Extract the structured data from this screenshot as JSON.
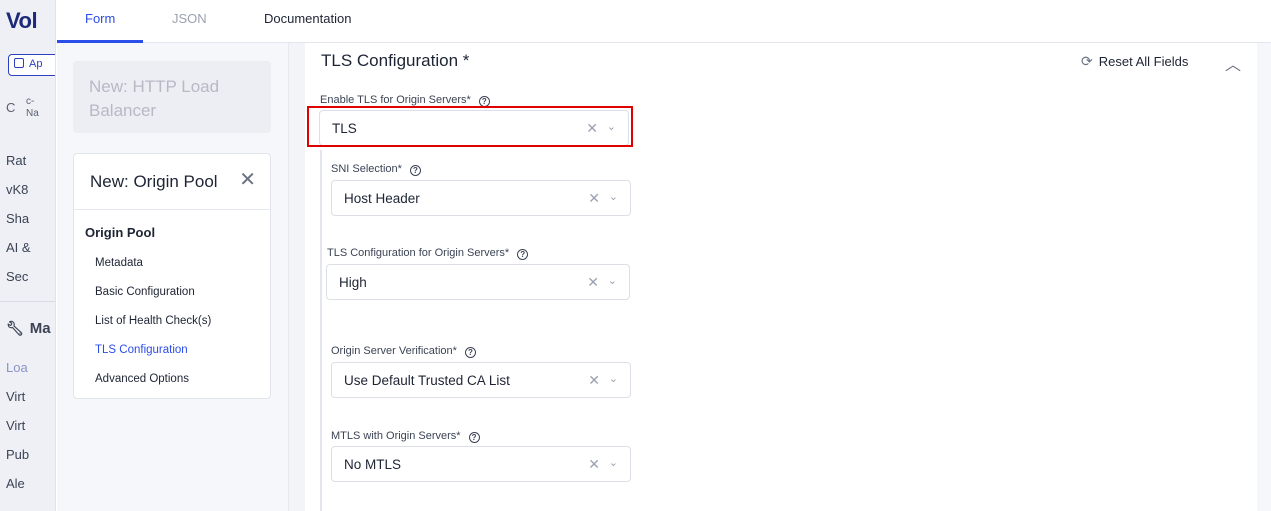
{
  "app_sidebar": {
    "logo": "Vol",
    "button_label": "Ap",
    "tenant_initial": "C",
    "tenant_line1": "c-",
    "tenant_line2": "Na",
    "nav_items": [
      {
        "label": "Rat"
      },
      {
        "label": "vK8"
      },
      {
        "label": "Sha"
      },
      {
        "label": "AI &"
      },
      {
        "label": "Sec"
      }
    ],
    "section_label": "Ma",
    "section_items": [
      {
        "label": "Loa",
        "active": true
      },
      {
        "label": "Virt"
      },
      {
        "label": "Virt"
      },
      {
        "label": "Pub"
      },
      {
        "label": "Ale"
      }
    ]
  },
  "tabs": [
    {
      "label": "Form",
      "active": true
    },
    {
      "label": "JSON"
    },
    {
      "label": "Documentation"
    }
  ],
  "left_panel": {
    "parent_card_title": "New: HTTP Load Balancer",
    "card_title": "New: Origin Pool",
    "close_icon": "✕",
    "heading": "Origin Pool",
    "items": [
      {
        "label": "Metadata"
      },
      {
        "label": "Basic Configuration"
      },
      {
        "label": "List of Health Check(s)"
      },
      {
        "label": "TLS Configuration",
        "active": true
      },
      {
        "label": "Advanced Options"
      }
    ]
  },
  "main": {
    "section_title": "TLS Configuration *",
    "reset_label": "Reset All Fields",
    "fields": [
      {
        "label": "Enable TLS for Origin Servers*",
        "value": "TLS"
      },
      {
        "label": "SNI Selection*",
        "value": "Host Header"
      },
      {
        "label": "TLS Configuration for Origin Servers*",
        "value": "High"
      },
      {
        "label": "Origin Server Verification*",
        "value": "Use Default Trusted CA List"
      },
      {
        "label": "MTLS with Origin Servers*",
        "value": "No MTLS"
      }
    ]
  },
  "colors": {
    "accent": "#2b4de8",
    "highlight": "#e00000"
  }
}
